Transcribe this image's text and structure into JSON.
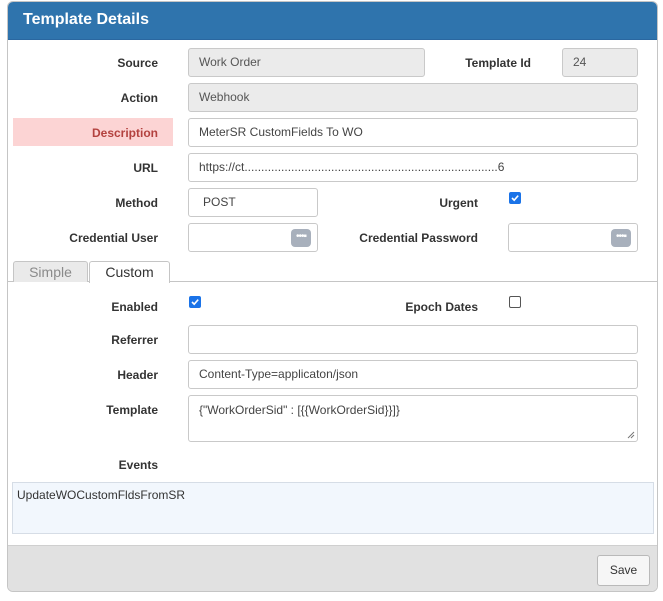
{
  "dialog": {
    "title": "Template Details"
  },
  "fields": {
    "source_label": "Source",
    "source_value": "Work Order",
    "template_id_label": "Template Id",
    "template_id_value": "24",
    "action_label": "Action",
    "action_value": "Webhook",
    "description_label": "Description",
    "description_value": "MeterSR CustomFields To WO",
    "url_label": "URL",
    "url_value": "https://ct............................................................................6",
    "method_label": "Method",
    "method_value": "POST",
    "urgent_label": "Urgent",
    "urgent_checked": true,
    "credential_user_label": "Credential User",
    "credential_password_label": "Credential Password",
    "password_icon": "dots-icon"
  },
  "tabs": [
    {
      "label": "Simple",
      "active": false
    },
    {
      "label": "Custom",
      "active": true
    }
  ],
  "custom": {
    "enabled_label": "Enabled",
    "enabled_checked": true,
    "epoch_label": "Epoch Dates",
    "epoch_checked": false,
    "referrer_label": "Referrer",
    "referrer_value": "",
    "header_label": "Header",
    "header_value": "Content-Type=applicaton/json",
    "template_label": "Template",
    "template_value": "{\"WorkOrderSid\" : [{{WorkOrderSid}}]}",
    "events_label": "Events",
    "events_value": "UpdateWOCustomFldsFromSR"
  },
  "footer": {
    "save_label": "Save"
  },
  "colors": {
    "title_bar": "#2f74ad",
    "error_highlight": "#fcd4d4",
    "checkbox": "#1a73e8"
  }
}
